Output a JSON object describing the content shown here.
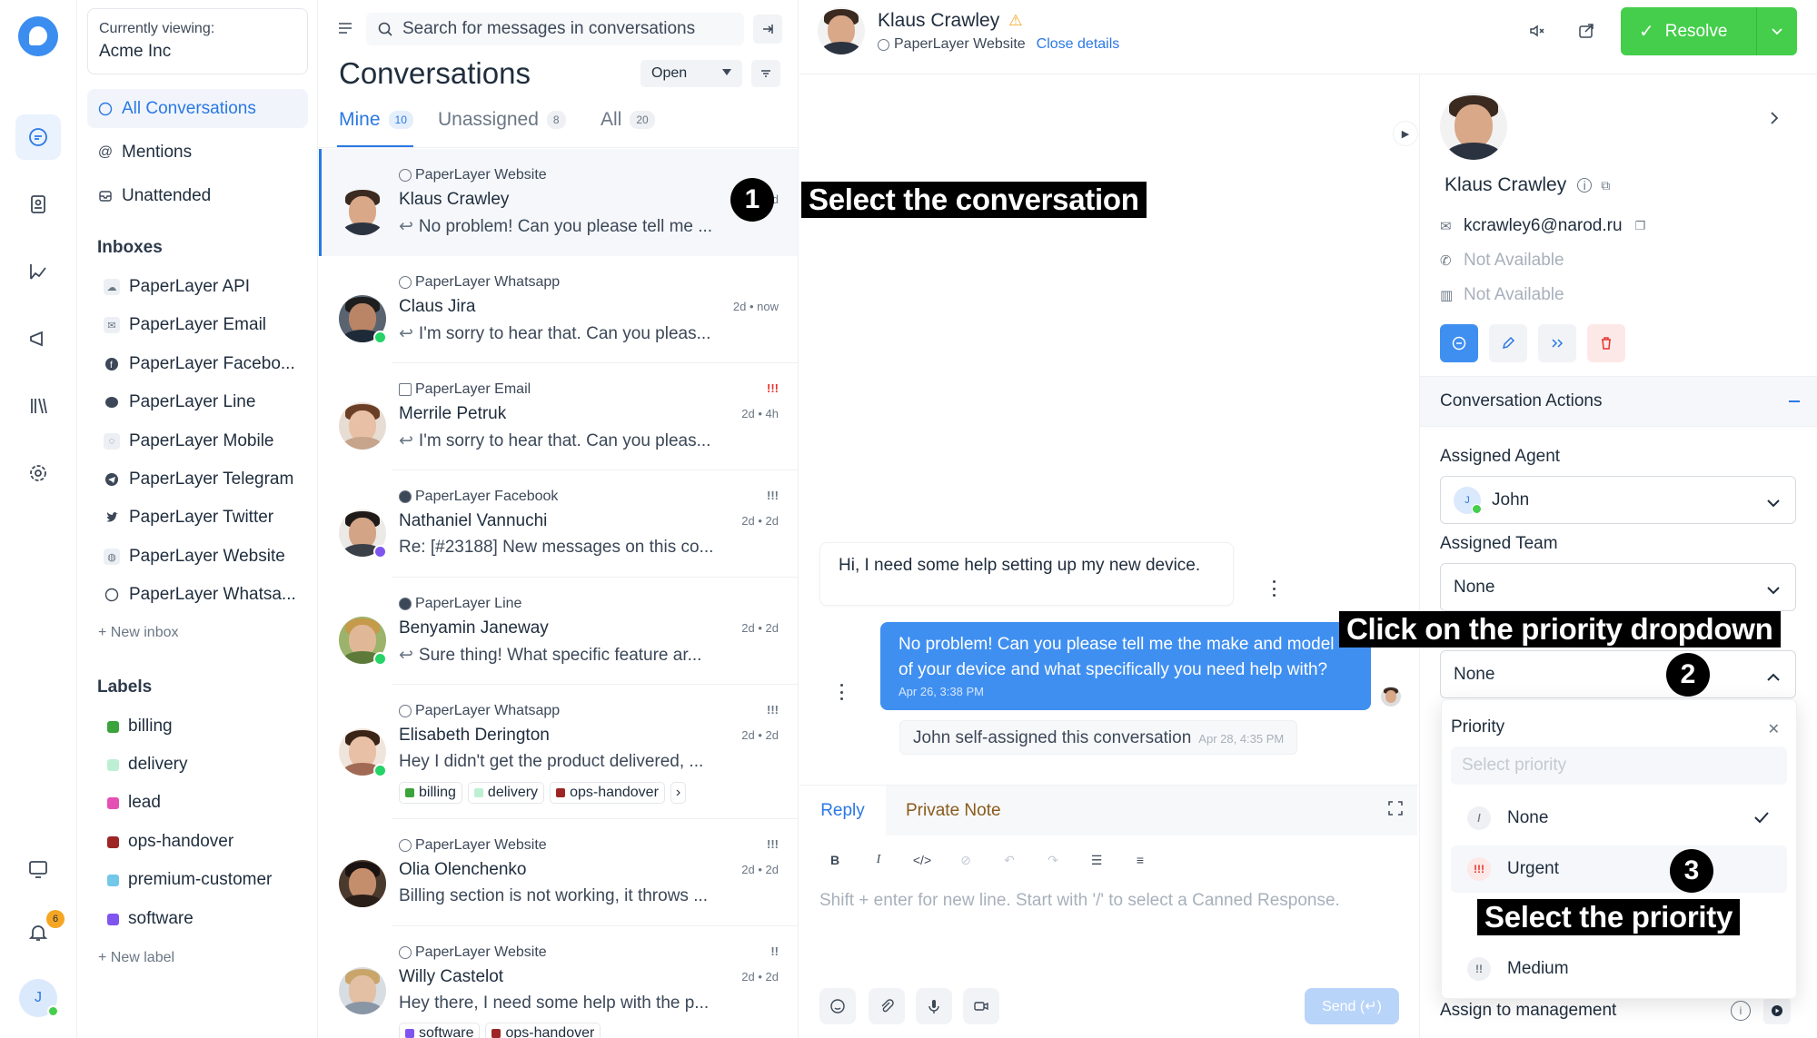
{
  "workspace": {
    "currently_viewing_label": "Currently viewing:",
    "account": "Acme Inc"
  },
  "nav": {
    "all_conversations": "All Conversations",
    "mentions": "Mentions",
    "unattended": "Unattended"
  },
  "inboxes": {
    "title": "Inboxes",
    "items": [
      "PaperLayer API",
      "PaperLayer Email",
      "PaperLayer Facebo...",
      "PaperLayer Line",
      "PaperLayer Mobile",
      "PaperLayer Telegram",
      "PaperLayer Twitter",
      "PaperLayer Website",
      "PaperLayer Whatsa..."
    ],
    "new_inbox": "+ New inbox"
  },
  "labels": {
    "title": "Labels",
    "items": [
      {
        "name": "billing",
        "color": "#3ba33b"
      },
      {
        "name": "delivery",
        "color": "#bdf0d2"
      },
      {
        "name": "lead",
        "color": "#e44fb3"
      },
      {
        "name": "ops-handover",
        "color": "#9e2525"
      },
      {
        "name": "premium-customer",
        "color": "#73c7e8"
      },
      {
        "name": "software",
        "color": "#7f55f0"
      }
    ],
    "new_label": "+ New label"
  },
  "rail": {
    "notification_count": "6",
    "user_initial": "J"
  },
  "list": {
    "search_placeholder": "Search for messages in conversations",
    "title": "Conversations",
    "status_filter": "Open",
    "tabs": [
      {
        "label": "Mine",
        "count": "10"
      },
      {
        "label": "Unassigned",
        "count": "8"
      },
      {
        "label": "All",
        "count": "20"
      }
    ],
    "conversations": [
      {
        "inbox": "PaperLayer Website",
        "name": "Klaus Crawley",
        "preview": "No problem! Can you please tell me ...",
        "time": "d",
        "priority": ""
      },
      {
        "inbox": "PaperLayer Whatsapp",
        "name": "Claus Jira",
        "preview": "I'm sorry to hear that. Can you pleas...",
        "time": "2d • now",
        "priority": ""
      },
      {
        "inbox": "PaperLayer Email",
        "name": "Merrile Petruk",
        "preview": "I'm sorry to hear that. Can you pleas...",
        "time": "2d • 4h",
        "priority": "!!!"
      },
      {
        "inbox": "PaperLayer Facebook",
        "name": "Nathaniel Vannuchi",
        "preview": "Re: [#23188] New messages on this co...",
        "time": "2d • 2d",
        "priority": "!!!"
      },
      {
        "inbox": "PaperLayer Line",
        "name": "Benyamin Janeway",
        "preview": "Sure thing! What specific feature ar...",
        "time": "2d • 2d",
        "priority": ""
      },
      {
        "inbox": "PaperLayer Whatsapp",
        "name": "Elisabeth Derington",
        "preview": "Hey I didn't get the product delivered, ...",
        "time": "2d • 2d",
        "priority": "!!!",
        "tags": [
          "billing",
          "delivery",
          "ops-handover"
        ]
      },
      {
        "inbox": "PaperLayer Website",
        "name": "Olia Olenchenko",
        "preview": "Billing section is not working, it throws ...",
        "time": "2d • 2d",
        "priority": "!!!"
      },
      {
        "inbox": "PaperLayer Website",
        "name": "Willy Castelot",
        "preview": "Hey there, I need some help with the p...",
        "time": "2d • 2d",
        "priority": "!!",
        "tags": [
          "software",
          "ops-handover"
        ]
      }
    ]
  },
  "chat": {
    "contact_name": "Klaus Crawley",
    "inbox": "PaperLayer Website",
    "close_details": "Close details",
    "resolve": "Resolve",
    "incoming_message": "Hi, I need some help setting up my new device.",
    "outgoing_message_line1": "No problem! Can you please tell me the make and model",
    "outgoing_message_line2": "of your device and what specifically you need help with?",
    "outgoing_time": "Apr 26, 3:38 PM",
    "activity": "John self-assigned this conversation",
    "activity_time": "Apr 28, 4:35 PM",
    "reply_tab": "Reply",
    "note_tab": "Private Note",
    "composer_placeholder": "Shift + enter for new line. Start with '/' to select a Canned Response.",
    "send": "Send (↵)"
  },
  "details": {
    "name": "Klaus Crawley",
    "email": "kcrawley6@narod.ru",
    "phone": "Not Available",
    "company": "Not Available",
    "section_title": "Conversation Actions",
    "assigned_agent_label": "Assigned Agent",
    "assigned_agent": "John",
    "agent_initial": "J",
    "assigned_team_label": "Assigned Team",
    "assigned_team": "None",
    "priority_value": "None",
    "assign_to_management": "Assign to management"
  },
  "priority_dropdown": {
    "title": "Priority",
    "search_placeholder": "Select priority",
    "options": [
      {
        "label": "None",
        "icon": "/",
        "selected": true
      },
      {
        "label": "Urgent",
        "icon": "!!!"
      },
      {
        "label": "Medium",
        "icon": "!!"
      }
    ]
  },
  "annotations": {
    "step1": "Select the conversation",
    "step2": "Click on the priority dropdown",
    "step3": "Select the priority",
    "n1": "1",
    "n2": "2",
    "n3": "3"
  }
}
